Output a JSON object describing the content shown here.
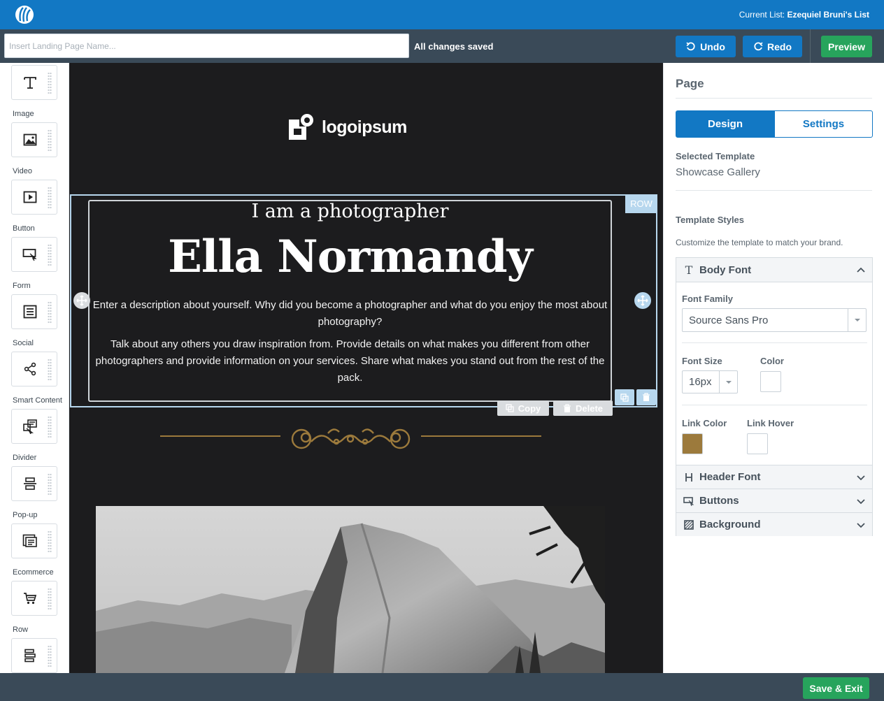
{
  "header": {
    "current_list_label": "Current List:",
    "current_list_name": "Ezequiel Bruni's List"
  },
  "toolbar": {
    "name_placeholder": "Insert Landing Page Name...",
    "name_value": "",
    "status": "All changes saved",
    "undo_label": "Undo",
    "redo_label": "Redo",
    "preview_label": "Preview"
  },
  "sidebar": {
    "tools": [
      {
        "label": "",
        "icon": "text-icon"
      },
      {
        "label": "Image",
        "icon": "image-icon"
      },
      {
        "label": "Video",
        "icon": "video-icon"
      },
      {
        "label": "Button",
        "icon": "button-icon"
      },
      {
        "label": "Form",
        "icon": "form-icon"
      },
      {
        "label": "Social",
        "icon": "share-icon"
      },
      {
        "label": "Smart Content",
        "icon": "smart-content-icon"
      },
      {
        "label": "Divider",
        "icon": "divider-icon"
      },
      {
        "label": "Pop-up",
        "icon": "popup-icon"
      },
      {
        "label": "Ecommerce",
        "icon": "cart-icon"
      },
      {
        "label": "Row",
        "icon": "row-icon"
      }
    ]
  },
  "canvas": {
    "brand_name": "logoipsum",
    "row_tag": "ROW",
    "subtitle": "I am a photographer",
    "name": "Ella Normandy",
    "description_1": "Enter a description about yourself. Why did you become a photographer and what do you enjoy the most about photography?",
    "description_2": "Talk about any others you draw inspiration from. Provide details on what makes you different from other photographers and provide information on your services. Share what makes you stand out from the rest of the pack.",
    "copy_label": "Copy",
    "delete_label": "Delete",
    "divider_color": "#9c7a3c",
    "background_color": "#1c1c1e"
  },
  "panel": {
    "title": "Page",
    "tabs": {
      "design": "Design",
      "settings": "Settings"
    },
    "selected_template_label": "Selected Template",
    "selected_template_value": "Showcase Gallery",
    "template_styles_label": "Template Styles",
    "template_styles_help": "Customize the template to match your brand.",
    "body_font": {
      "header": "Body Font",
      "font_family_label": "Font Family",
      "font_family_value": "Source Sans Pro",
      "font_size_label": "Font Size",
      "font_size_value": "16px",
      "color_label": "Color",
      "color_value": "#ffffff",
      "link_color_label": "Link Color",
      "link_color_value": "#9c7a3c",
      "link_hover_label": "Link Hover",
      "link_hover_value": "#ffffff"
    },
    "sections": [
      {
        "label": "Header Font",
        "icon": "header-icon"
      },
      {
        "label": "Buttons",
        "icon": "button-icon"
      },
      {
        "label": "Background",
        "icon": "background-icon"
      }
    ]
  },
  "footer": {
    "save_exit_label": "Save & Exit"
  },
  "colors": {
    "brand_blue": "#1278c4",
    "toolbar_dark": "#3a4a58",
    "success_green": "#27a45c"
  }
}
